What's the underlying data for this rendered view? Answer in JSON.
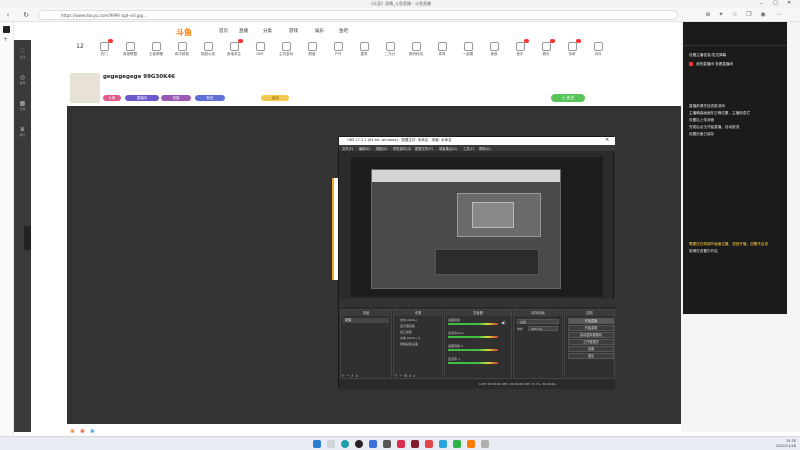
{
  "window": {
    "title": "《天涯》直播_斗鱼直播 - 斗鱼直播"
  },
  "browser": {
    "url": "https://www.douyu.com/9999 sgd-vid.jpg ..."
  },
  "site": {
    "logo": "斗鱼",
    "topnav": [
      "首页",
      "直播",
      "分类",
      "游戏",
      "娱乐",
      "鱼吧"
    ],
    "nav_left": [
      "关注",
      "推荐",
      "分类",
      "排行"
    ],
    "categories": [
      "12",
      "热门",
      "英雄联盟",
      "王者荣耀",
      "和平精英",
      "穿越火线",
      "绝地求生",
      "DNF",
      "主机游戏",
      "颜值",
      "户外",
      "星秀",
      "二次元",
      "数码科技",
      "体育",
      "一起看",
      "美食",
      "音乐",
      "聊天",
      "传奇",
      "派对"
    ],
    "streamer": {
      "name": "gegegegege 99G30K46",
      "tags": [
        "斗鱼",
        "直播中",
        "贵族",
        "粉丝",
        "活动"
      ],
      "follow": "+ 关注"
    }
  },
  "obs": {
    "title": "OBS 27.2.1 (64-bit, windows) - 配置文件: 未命名 - 场景: 未命名",
    "menu": [
      "文件(F)",
      "编辑(E)",
      "视图(V)",
      "停靠部件(D)",
      "配置文件(P)",
      "场景集合(S)",
      "工具(T)",
      "帮助(H)"
    ],
    "docks": [
      "场景",
      "来源",
      "混音器",
      "转场动画",
      "控制"
    ],
    "scene": "场景",
    "sources": [
      "文本 (GDI+)",
      "显示器采集",
      "窗口采集",
      "文本 (GDI+) 2",
      "视频采集设备"
    ],
    "mixer": [
      "桌面音频",
      "麦克风/Aux",
      "桌面音频 2",
      "麦克风 3"
    ],
    "transition": {
      "type": "淡出",
      "duration_label": "时长",
      "duration": "300 ms"
    },
    "controls": [
      "开始直播",
      "开始录制",
      "启动虚拟摄像机",
      "工作室模式",
      "设置",
      "退出"
    ],
    "status": "LIVE: 00:00:00   REC: 00:00:00   CPU: 3.1%, 30.00 fps"
  },
  "overlay": {
    "lines": [
      "设置主播信息/发送弹幕",
      "我的直播间   查看直播间",
      "",
      "直播前请先检查推流码",
      "主播确保画面在正确位置，主播信息栏",
      "设置后上传封面",
      "完成后点击开始直播，自动推流",
      "设置页面已保存",
      "",
      "需要在右侧调节画面位置，语音开播，如需开启录",
      "制请在设置中开启"
    ],
    "highlight": "开始直播"
  },
  "taskbar": {
    "time": "15:30",
    "date": "2022/11/16"
  }
}
